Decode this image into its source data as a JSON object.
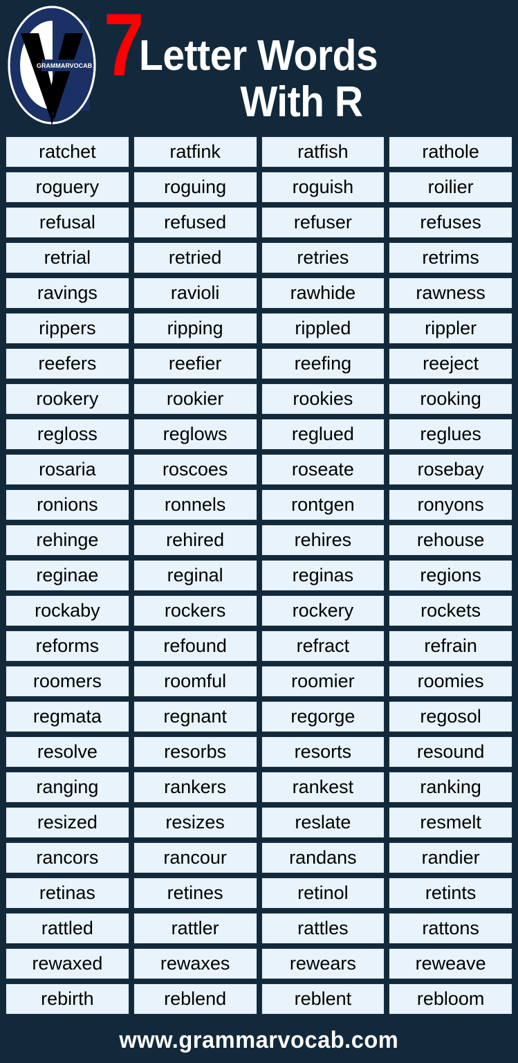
{
  "header": {
    "logo_text": "GRAMMARVOCAB",
    "count": "7",
    "title_line1": "Letter Words",
    "title_line2": "With R",
    "accent_red": "#ff0000",
    "background": "#12293b",
    "cell_background": "#e8f3fb"
  },
  "footer": {
    "website": "www.grammarvocab.com"
  },
  "grid": {
    "columns": 4,
    "rows": [
      [
        "ratchet",
        "ratfink",
        "ratfish",
        "rathole"
      ],
      [
        "roguery",
        "roguing",
        "roguish",
        "roilier"
      ],
      [
        "refusal",
        "refused",
        "refuser",
        "refuses"
      ],
      [
        "retrial",
        "retried",
        "retries",
        "retrims"
      ],
      [
        "ravings",
        "ravioli",
        "rawhide",
        "rawness"
      ],
      [
        "rippers",
        "ripping",
        "rippled",
        "rippler"
      ],
      [
        "reefers",
        "reefier",
        "reefing",
        "reeject"
      ],
      [
        "rookery",
        "rookier",
        "rookies",
        "rooking"
      ],
      [
        "regloss",
        "reglows",
        "reglued",
        "reglues"
      ],
      [
        "rosaria",
        "roscoes",
        "roseate",
        "rosebay"
      ],
      [
        "ronions",
        "ronnels",
        "rontgen",
        "ronyons"
      ],
      [
        "rehinge",
        "rehired",
        "rehires",
        "rehouse"
      ],
      [
        "reginae",
        "reginal",
        "reginas",
        "regions"
      ],
      [
        "rockaby",
        "rockers",
        "rockery",
        "rockets"
      ],
      [
        "reforms",
        "refound",
        "refract",
        "refrain"
      ],
      [
        "roomers",
        "roomful",
        "roomier",
        "roomies"
      ],
      [
        "regmata",
        "regnant",
        "regorge",
        "regosol"
      ],
      [
        "resolve",
        "resorbs",
        "resorts",
        "resound"
      ],
      [
        "ranging",
        "rankers",
        "rankest",
        "ranking"
      ],
      [
        "resized",
        "resizes",
        "reslate",
        "resmelt"
      ],
      [
        "rancors",
        "rancour",
        "randans",
        "randier"
      ],
      [
        "retinas",
        "retines",
        "retinol",
        "retints"
      ],
      [
        "rattled",
        "rattler",
        "rattles",
        "rattons"
      ],
      [
        "rewaxed",
        "rewaxes",
        "rewears",
        "reweave"
      ],
      [
        "rebirth",
        "reblend",
        "reblent",
        "rebloom"
      ]
    ]
  }
}
